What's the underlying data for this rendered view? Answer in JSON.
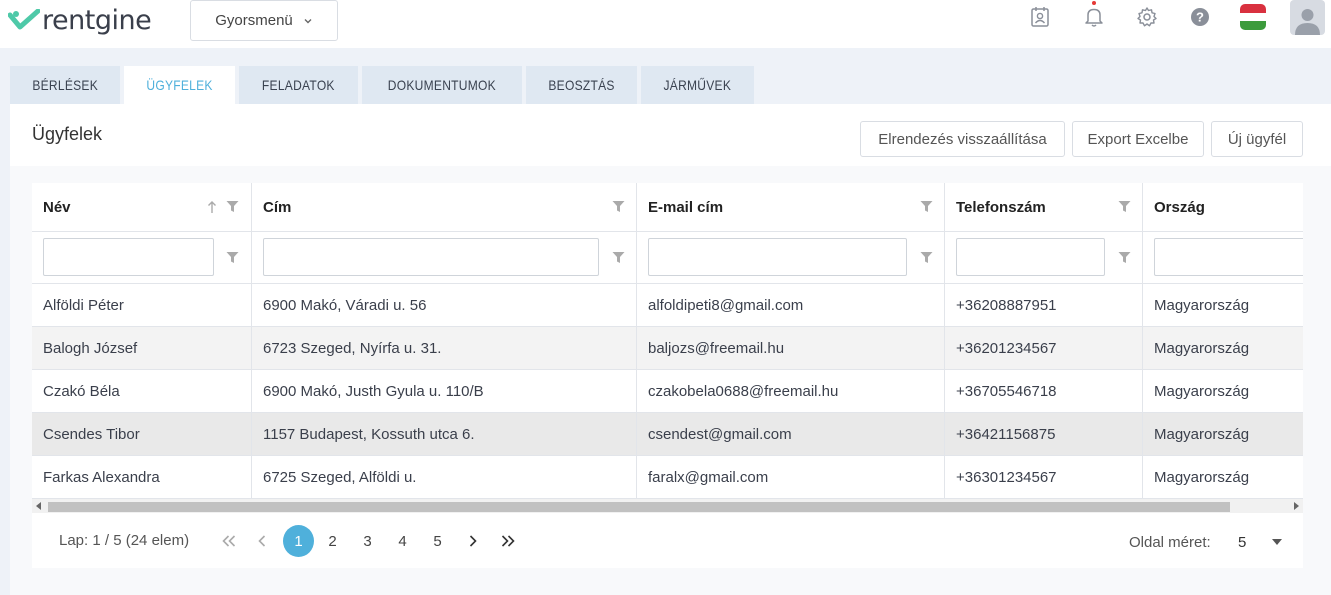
{
  "app": {
    "logo_text": "rentgine",
    "quick_menu_label": "Gyorsmenü"
  },
  "top_icons": [
    "contacts-icon",
    "bell-icon",
    "gear-icon",
    "help-icon",
    "hungarian-flag-icon",
    "user-avatar-icon"
  ],
  "colors": {
    "accent": "#4fb0db",
    "brand_green": "#4ec9a8",
    "flag_red": "#d9313f",
    "flag_white": "#ffffff",
    "flag_green": "#3c9b3c"
  },
  "tabs": [
    {
      "label": "BÉRLÉSEK",
      "active": false
    },
    {
      "label": "ÜGYFELEK",
      "active": true
    },
    {
      "label": "FELADATOK",
      "active": false
    },
    {
      "label": "DOKUMENTUMOK",
      "active": false
    },
    {
      "label": "BEOSZTÁS",
      "active": false
    },
    {
      "label": "JÁRMŰVEK",
      "active": false
    }
  ],
  "page": {
    "title": "Ügyfelek",
    "buttons": {
      "reset_layout": "Elrendezés visszaállítása",
      "export_excel": "Export Excelbe",
      "new_client": "Új ügyfél"
    }
  },
  "table": {
    "columns": [
      "Név",
      "Cím",
      "E-mail cím",
      "Telefonszám",
      "Ország"
    ],
    "rows": [
      [
        "Alföldi Péter",
        "6900 Makó, Váradi u. 56",
        "alfoldipeti8@gmail.com",
        "+36208887951",
        "Magyarország"
      ],
      [
        "Balogh József",
        "6723 Szeged, Nyírfa u. 31.",
        "baljozs@freemail.hu",
        "+36201234567",
        "Magyarország"
      ],
      [
        "Czakó Béla",
        "6900 Makó, Justh Gyula u. 110/B",
        "czakobela0688@freemail.hu",
        "+36705546718",
        "Magyarország"
      ],
      [
        "Csendes Tibor",
        "1157 Budapest, Kossuth utca 6.",
        "csendest@gmail.com",
        "+36421156875",
        "Magyarország"
      ],
      [
        "Farkas Alexandra",
        "6725 Szeged, Alföldi u.",
        "faralx@gmail.com",
        "+36301234567",
        "Magyarország"
      ]
    ]
  },
  "pagination": {
    "info": "Lap: 1 / 5 (24 elem)",
    "pages": [
      "1",
      "2",
      "3",
      "4",
      "5"
    ],
    "current_page": "1",
    "page_size_label": "Oldal méret:",
    "page_size": "5"
  }
}
